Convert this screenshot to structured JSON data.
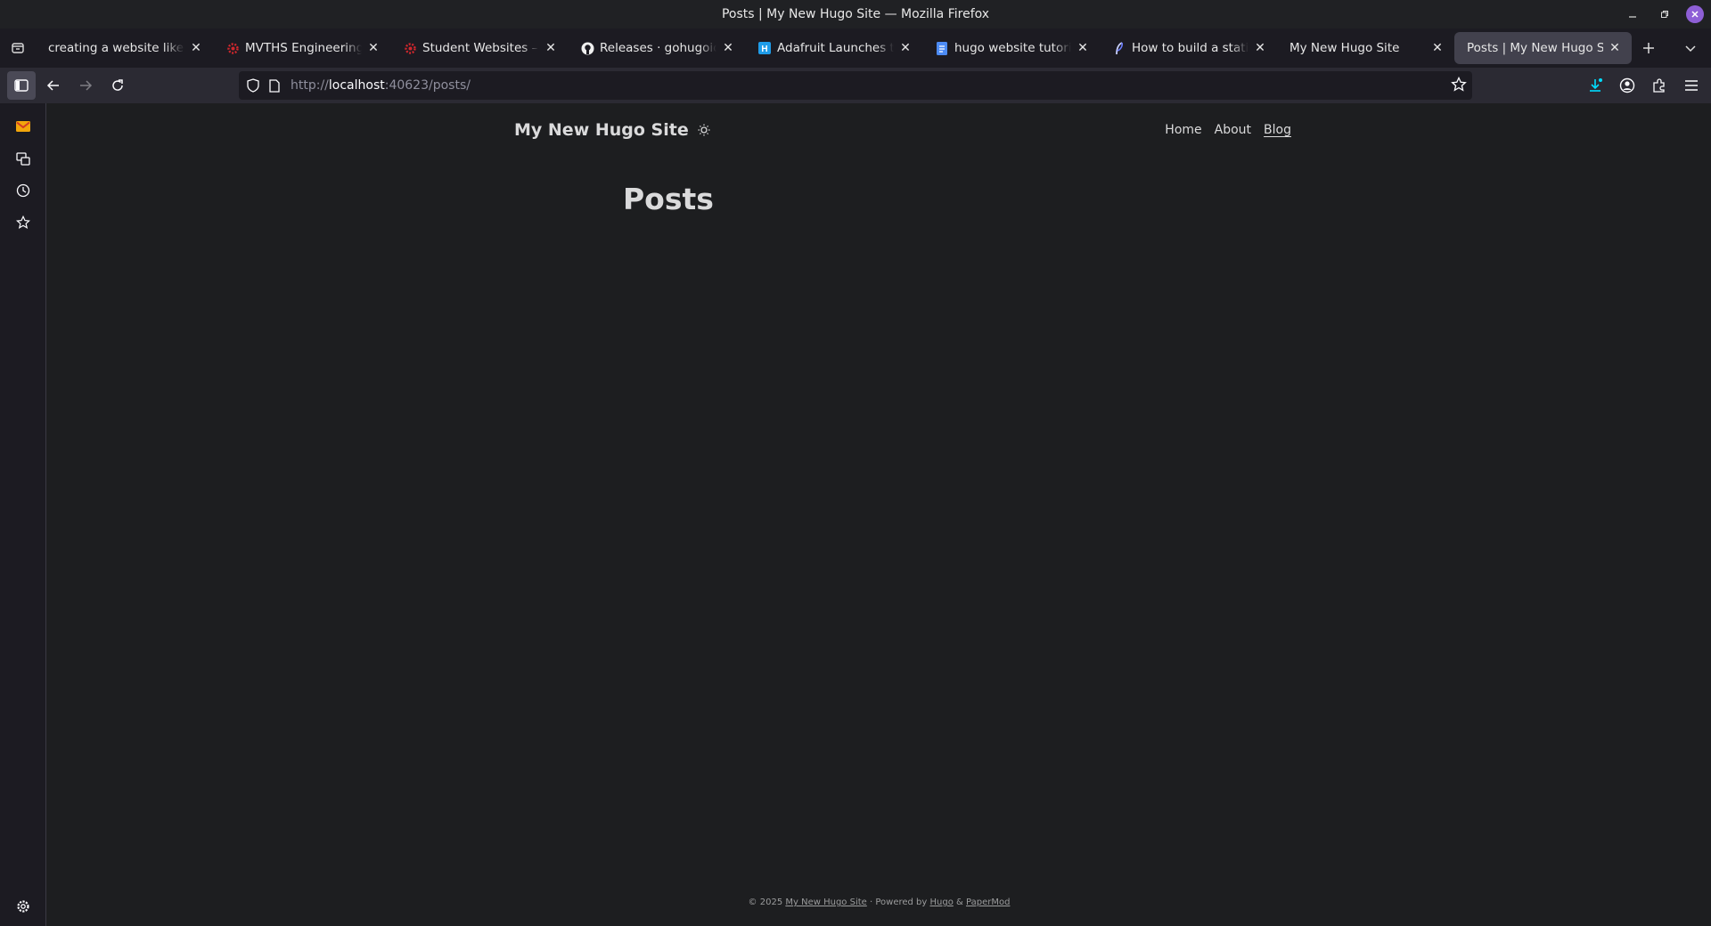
{
  "window": {
    "title": "Posts | My New Hugo Site — Mozilla Firefox"
  },
  "tabs": [
    {
      "label": "creating a website like this",
      "favicon": "none",
      "active": false
    },
    {
      "label": "MVTHS Engineering – M",
      "favicon": "gear-red-icon",
      "active": false
    },
    {
      "label": "Student Websites – MV",
      "favicon": "gear-red-icon",
      "active": false
    },
    {
      "label": "Releases · gohugoio/hu",
      "favicon": "github-icon",
      "active": false
    },
    {
      "label": "Adafruit Launches the K",
      "favicon": "hackster-icon",
      "active": false
    },
    {
      "label": "hugo website tutorial th",
      "favicon": "docs-icon",
      "active": false
    },
    {
      "label": "How to build a static sit",
      "favicon": "feather-icon",
      "active": false
    },
    {
      "label": "My New Hugo Site",
      "favicon": "none",
      "active": false
    },
    {
      "label": "Posts | My New Hugo Site",
      "favicon": "none",
      "active": true
    }
  ],
  "urlbar": {
    "scheme": "http://",
    "host": "localhost",
    "rest": ":40623/posts/"
  },
  "site": {
    "logo": "My New Hugo Site",
    "menu": [
      {
        "label": "Home",
        "active": false
      },
      {
        "label": "About",
        "active": false
      },
      {
        "label": "Blog",
        "active": true
      }
    ],
    "page_title": "Posts"
  },
  "footer": {
    "copyright": "© 2025",
    "site_link": "My New Hugo Site",
    "powered_by": "· Powered by",
    "hugo": "Hugo",
    "amp": "&",
    "theme": "PaperMod"
  },
  "colors": {
    "page_bg": "#1d1e20",
    "chrome_bg": "#2b2a33",
    "tab_active": "#42414d",
    "accent_download": "#00ddff"
  }
}
